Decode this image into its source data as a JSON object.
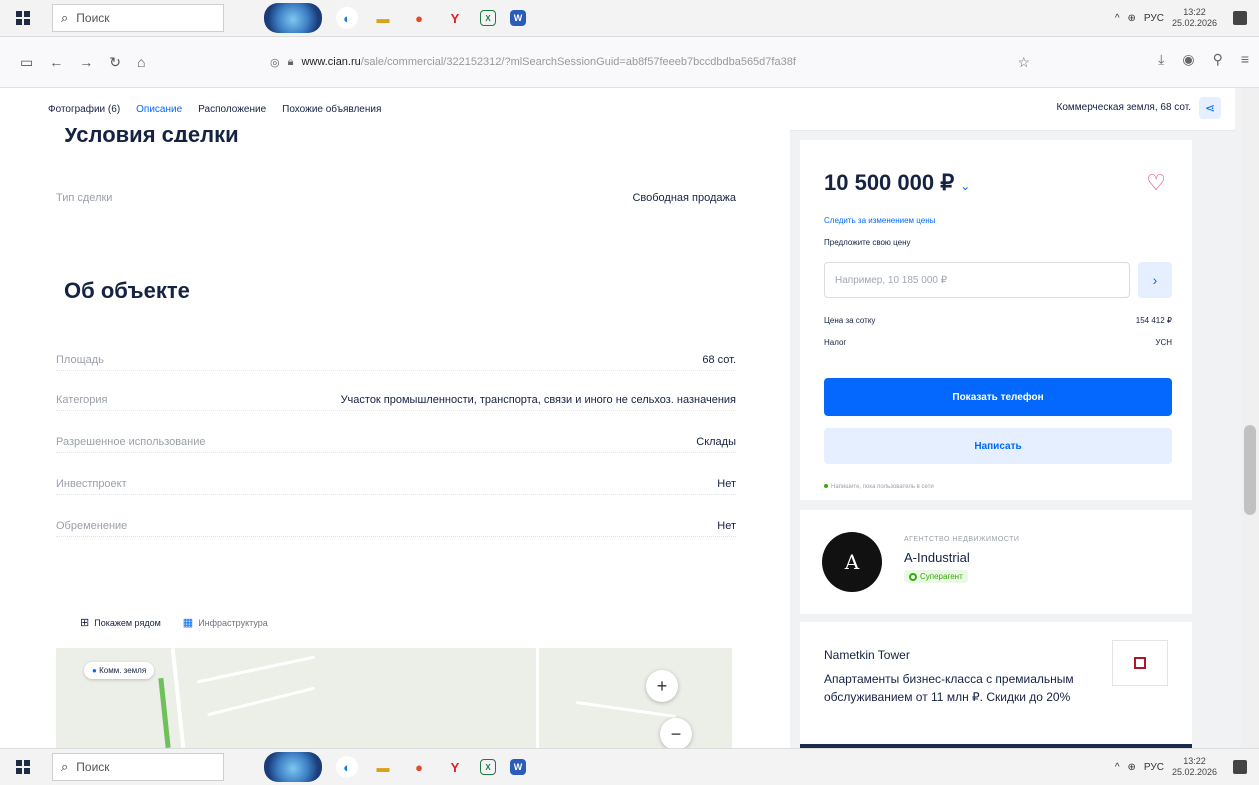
{
  "taskbar": {
    "search_placeholder": "Поиск",
    "language": "РУС",
    "time": "13:22",
    "date": "25.02.2026",
    "apps": [
      "edge-icon",
      "file-explorer-icon",
      "yandex-browser-icon",
      "yandex-icon",
      "excel-icon",
      "word-icon"
    ]
  },
  "browser": {
    "url_domain": "www.cian.ru",
    "url_path": "/sale/commercial/322152312/?mlSearchSessionGuid=ab8f57feeeb7bccdbdba565d7fa38f"
  },
  "nav": {
    "tabs": [
      "Фотографии (6)",
      "Описание",
      "Расположение",
      "Похожие объявления"
    ],
    "active_tab": "Описание",
    "title": "Коммерческая земля, 68 сот."
  },
  "conditions": {
    "heading": "Условия сделки",
    "deal_type_label": "Тип сделки",
    "deal_type_value": "Свободная продажа"
  },
  "object": {
    "heading": "Об объекте",
    "rows": [
      {
        "label": "Площадь",
        "value": "68 сот."
      },
      {
        "label": "Категория",
        "value": "Участок промышленности, транспорта, связи и иного не сельхоз. назначения"
      },
      {
        "label": "Разрешенное использование",
        "value": "Склады"
      },
      {
        "label": "Инвестпроект",
        "value": "Нет"
      },
      {
        "label": "Обременение",
        "value": "Нет"
      }
    ]
  },
  "map": {
    "tab_nearby": "Покажем рядом",
    "tab_infra": "Инфраструктура",
    "pin_label": "Комм. земля"
  },
  "sidebar": {
    "price": "10 500 000 ₽",
    "follow_price": "Следить за изменением цены",
    "offer_label": "Предложите свою цену",
    "offer_placeholder": "Например, 10 185 000 ₽",
    "price_per_label": "Цена за сотку",
    "price_per_value": "154 412 ₽",
    "tax_label": "Налог",
    "tax_value": "УСН",
    "show_phone": "Показать телефон",
    "write": "Написать",
    "online_note": "Напишите, пока пользователь в сети"
  },
  "agency": {
    "type": "АГЕНТСТВО НЕДВИЖИМОСТИ",
    "name": "A-Industrial",
    "badge": "Суперагент",
    "logo_letter": "A"
  },
  "ad": {
    "title": "Nametkin Tower",
    "text": "Апартаменты бизнес-класса с премиальным обслуживанием от 11 млн ₽. Скидки до 20%"
  },
  "colors": {
    "accent": "#0468ff",
    "accent_light": "#e6efff",
    "text": "#152242",
    "muted": "#9aa0ab",
    "success": "#34ac0a"
  }
}
